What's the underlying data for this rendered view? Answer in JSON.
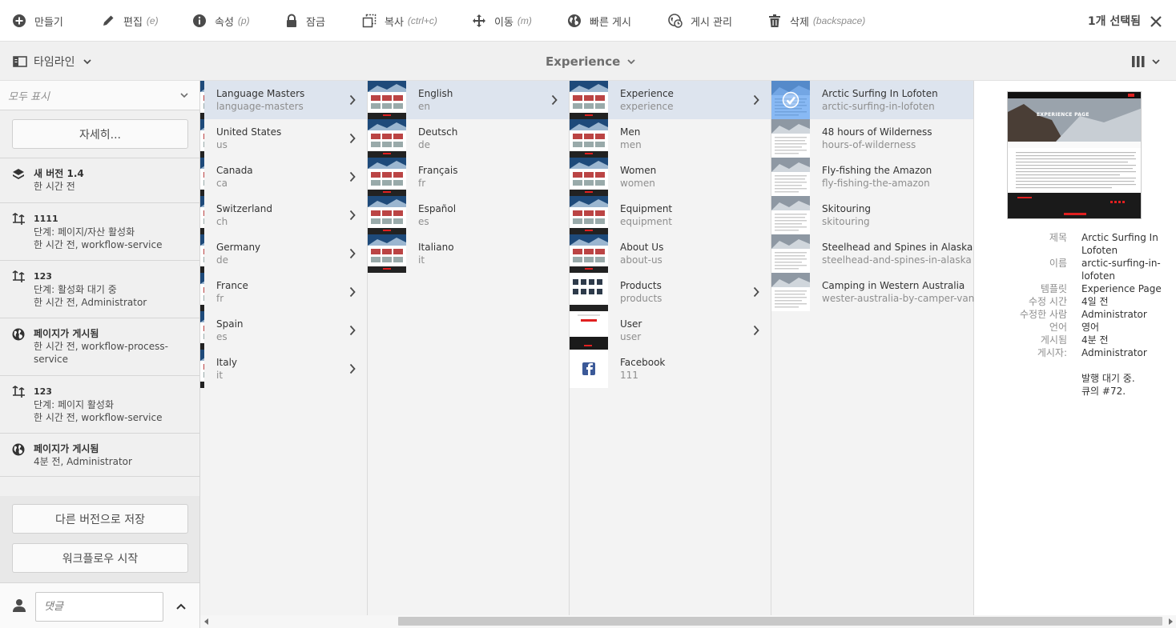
{
  "toolbar": {
    "create": "만들기",
    "edit": "편집",
    "edit_key": "(e)",
    "properties": "속성",
    "properties_key": "(p)",
    "lock": "잠금",
    "copy": "복사",
    "copy_key": "(ctrl+c)",
    "move": "이동",
    "move_key": "(m)",
    "quick_publish": "빠른 게시",
    "manage_publication": "게시 관리",
    "delete": "삭제",
    "delete_key": "(backspace)",
    "selected": "1개 선택됨"
  },
  "subbar": {
    "rail_label": "타임라인",
    "title": "Experience"
  },
  "rail": {
    "filter": "모두 표시",
    "more_button": "자세히...",
    "items": [
      {
        "title": "새 버전 1.4",
        "line1": "한 시간 전",
        "icon": "layers-icon"
      },
      {
        "title": "1111",
        "line1": "단계: 페이지/자산 활성화",
        "line2": "한 시간 전, workflow-service",
        "icon": "workflow-icon"
      },
      {
        "title": "123",
        "line1": "단계: 활성화 대기 중",
        "line2": "한 시간 전, Administrator",
        "icon": "workflow-icon"
      },
      {
        "title": "페이지가 게시됨",
        "line1": "한 시간 전, workflow-process-",
        "line2": "service",
        "icon": "globe-icon"
      },
      {
        "title": "123",
        "line1": "단계: 페이지 활성화",
        "line2": "한 시간 전, workflow-service",
        "icon": "workflow-icon"
      },
      {
        "title": "페이지가 게시됨",
        "line1": "4분 전, Administrator",
        "icon": "globe-icon"
      }
    ],
    "save_as_version": "다른 버전으로 저장",
    "start_workflow": "워크플로우 시작",
    "comment_placeholder": "댓글"
  },
  "columns": [
    {
      "items": [
        {
          "title": "Language Masters",
          "name": "language-masters",
          "children": true,
          "active": true
        },
        {
          "title": "United States",
          "name": "us",
          "children": true
        },
        {
          "title": "Canada",
          "name": "ca",
          "children": true
        },
        {
          "title": "Switzerland",
          "name": "ch",
          "children": true
        },
        {
          "title": "Germany",
          "name": "de",
          "children": true
        },
        {
          "title": "France",
          "name": "fr",
          "children": true
        },
        {
          "title": "Spain",
          "name": "es",
          "children": true
        },
        {
          "title": "Italy",
          "name": "it",
          "children": true
        }
      ]
    },
    {
      "items": [
        {
          "title": "English",
          "name": "en",
          "children": true,
          "active": true
        },
        {
          "title": "Deutsch",
          "name": "de"
        },
        {
          "title": "Français",
          "name": "fr"
        },
        {
          "title": "Español",
          "name": "es"
        },
        {
          "title": "Italiano",
          "name": "it"
        }
      ]
    },
    {
      "items": [
        {
          "title": "Experience",
          "name": "experience",
          "children": true,
          "active": true
        },
        {
          "title": "Men",
          "name": "men"
        },
        {
          "title": "Women",
          "name": "women"
        },
        {
          "title": "Equipment",
          "name": "equipment"
        },
        {
          "title": "About Us",
          "name": "about-us"
        },
        {
          "title": "Products",
          "name": "products",
          "children": true
        },
        {
          "title": "User",
          "name": "user",
          "children": true
        },
        {
          "title": "Facebook",
          "name": "111",
          "icon": "facebook-icon"
        }
      ]
    },
    {
      "items": [
        {
          "title": "Arctic Surfing In Lofoten",
          "name": "arctic-surfing-in-lofoten",
          "active": true,
          "selected": true
        },
        {
          "title": "48 hours of Wilderness",
          "name": "hours-of-wilderness"
        },
        {
          "title": "Fly-fishing the Amazon",
          "name": "fly-fishing-the-amazon"
        },
        {
          "title": "Skitouring",
          "name": "skitouring"
        },
        {
          "title": "Steelhead and Spines in Alaska",
          "name": "steelhead-and-spines-in-alaska"
        },
        {
          "title": "Camping in Western Australia",
          "name": "wester-australia-by-camper-van"
        }
      ]
    }
  ],
  "preview": {
    "preview_heading": "EXPERIENCE PAGE",
    "meta": [
      {
        "key": "제목",
        "lines": [
          "Arctic Surfing In",
          "Lofoten"
        ]
      },
      {
        "key": "이름",
        "lines": [
          "arctic-surfing-in-",
          "lofoten"
        ]
      },
      {
        "key": "템플릿",
        "lines": [
          "Experience Page"
        ]
      },
      {
        "key": "수정 시간",
        "lines": [
          "4일 전"
        ]
      },
      {
        "key": "수정한 사람",
        "lines": [
          "Administrator"
        ]
      },
      {
        "key": "언어",
        "lines": [
          "영어"
        ]
      },
      {
        "key": "게시됨",
        "lines": [
          "4분 전"
        ]
      },
      {
        "key": "게시자:",
        "lines": [
          "Administrator"
        ]
      }
    ],
    "status_line1": "발행 대기 중.",
    "status_line2": "큐의 #72."
  },
  "colors": {
    "accent": "#2680eb",
    "active_row": "#dde4ee",
    "rail_bg": "#f0f0f0",
    "column_bg": "#f3f3f3"
  }
}
